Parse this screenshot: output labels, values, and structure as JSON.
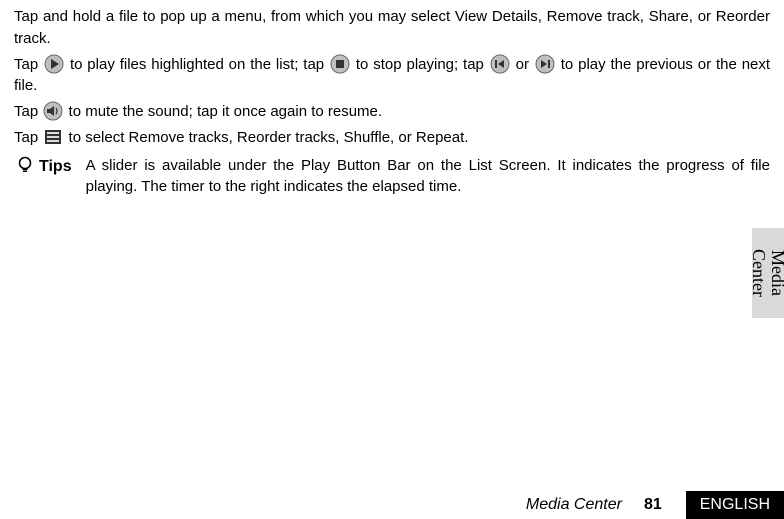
{
  "paragraphs": {
    "p1": "Tap and hold a file to pop up a menu, from which you may select View Details, Remove track, Share, or Reorder track.",
    "p2a": "Tap",
    "p2b": "to play files highlighted on the list; tap",
    "p2c": "to stop playing; tap",
    "p2d": "or",
    "p2e": "to play the previous or the next file.",
    "p3a": "Tap",
    "p3b": "to mute the sound; tap it once again to resume.",
    "p4a": "Tap",
    "p4b": "to select Remove tracks, Reorder tracks, Shuffle, or Repeat."
  },
  "tips": {
    "label": "Tips",
    "body": "A slider is available under the Play Button Bar on the List Screen. It indicates the progress of file playing. The timer to the right indicates the elapsed time."
  },
  "side_tab": "Media Center",
  "footer": {
    "section": "Media Center",
    "page": "81",
    "language": "ENGLISH"
  }
}
